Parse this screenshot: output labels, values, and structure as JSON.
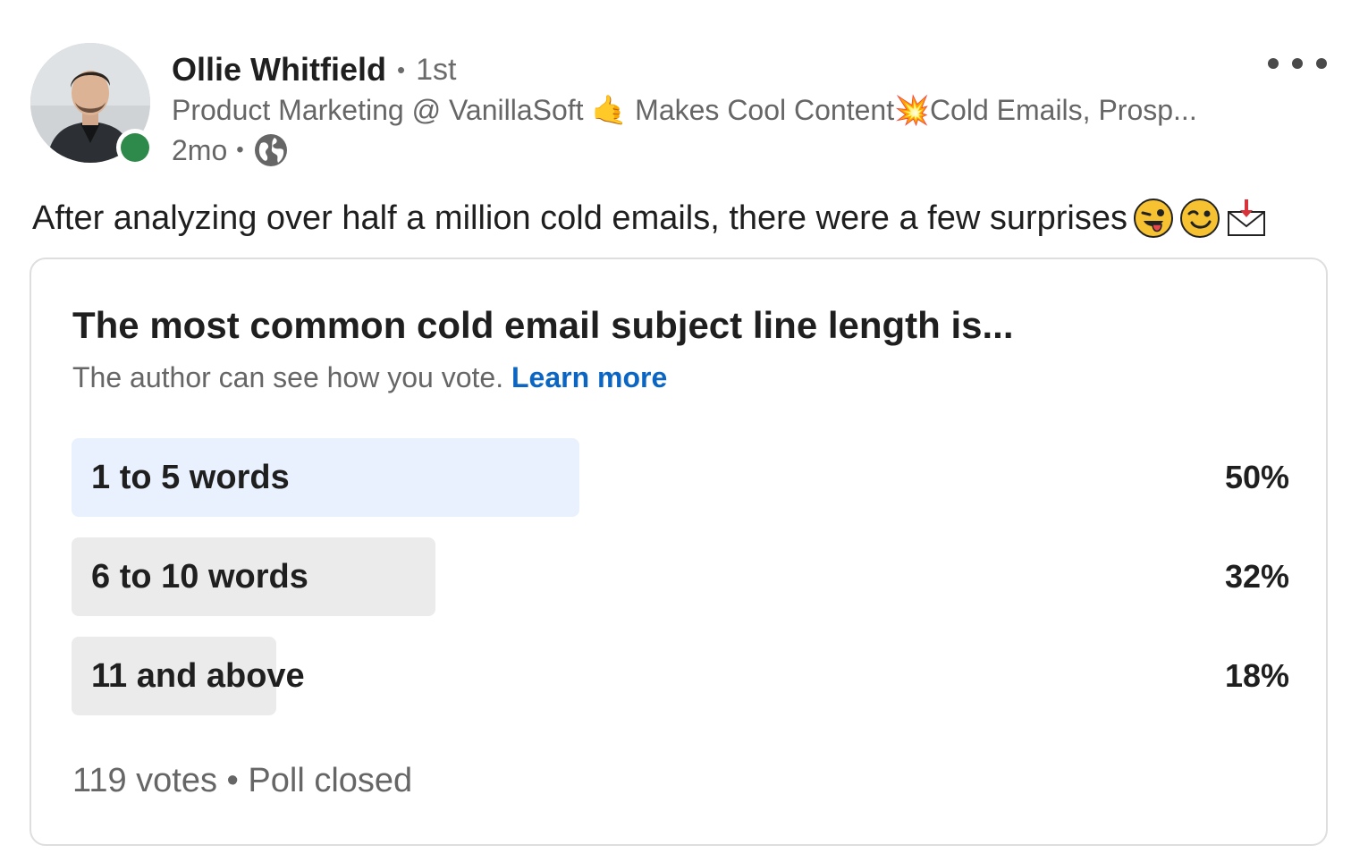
{
  "author": {
    "name": "Ollie Whitfield",
    "separator": "•",
    "connection_degree": "1st",
    "headline": "Product Marketing @ VanillaSoft 🤙 Makes Cool Content💥Cold Emails, Prosp...",
    "posted_time": "2mo",
    "meta_separator": "•",
    "visibility_icon": "globe-icon",
    "online_status_color": "#2e8a4a"
  },
  "post": {
    "text": "After analyzing over half a million cold emails, there were a few surprises",
    "emojis": [
      "zany-face-emoji",
      "winking-face-emoji",
      "envelope-arrow-emoji"
    ]
  },
  "more_menu_icon": "more-horizontal-icon",
  "poll": {
    "question": "The most common cold email subject line length is...",
    "note": "The author can see how you vote.",
    "learn_more_label": "Learn more",
    "options": [
      {
        "label": "1 to 5 words",
        "percent_label": "50%",
        "percent": 50,
        "selected": true
      },
      {
        "label": "6 to 10 words",
        "percent_label": "32%",
        "percent": 32,
        "selected": false
      },
      {
        "label": "11 and above",
        "percent_label": "18%",
        "percent": 18,
        "selected": false
      }
    ],
    "votes": "119 votes",
    "footer_separator": "•",
    "status": "Poll closed",
    "selected_bar_color": "#e8f1fd",
    "bar_color": "#ebebeb",
    "link_color": "#0a66c2"
  }
}
